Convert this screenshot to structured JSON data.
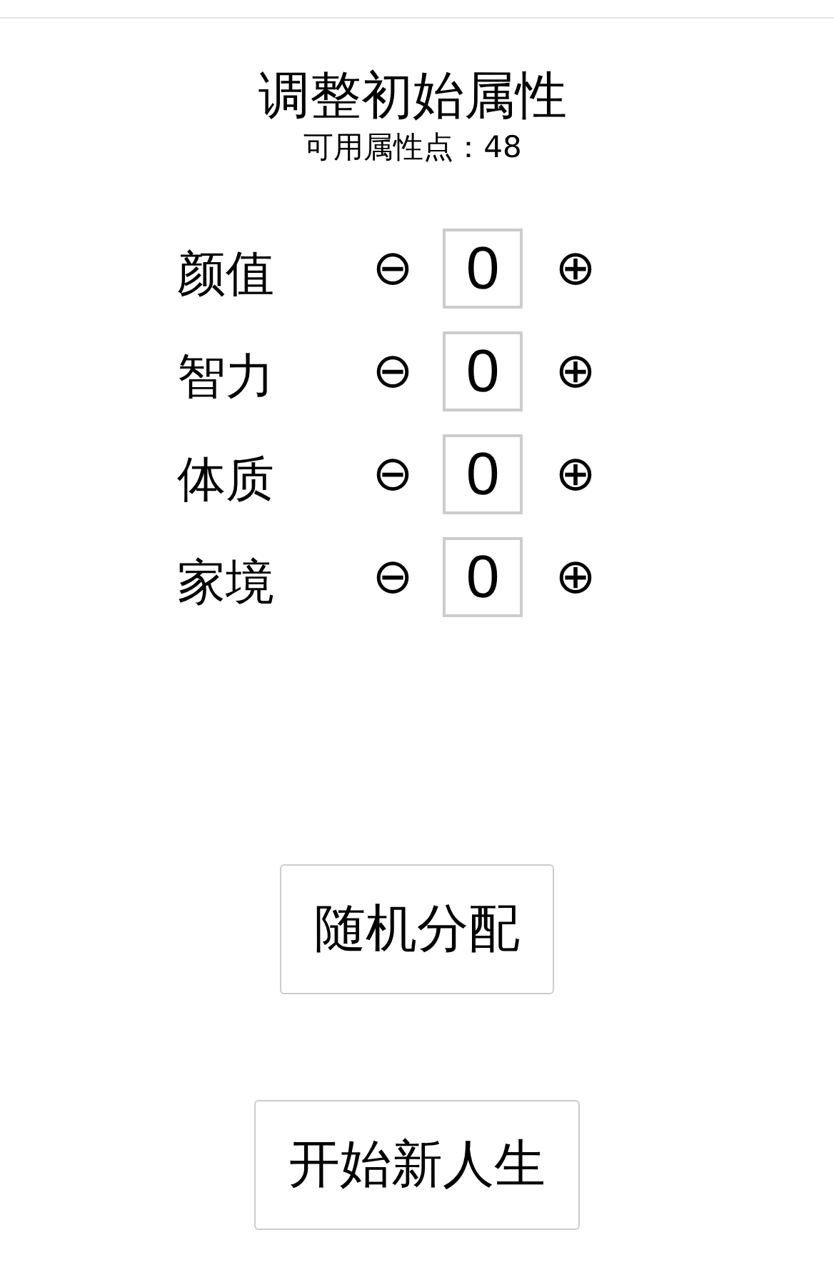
{
  "title": "调整初始属性",
  "available_points": {
    "label": "可用属性点：",
    "value": "48"
  },
  "attributes": [
    {
      "name": "颜值",
      "minus": "⊖",
      "value": "0",
      "plus": "⊕"
    },
    {
      "name": "智力",
      "minus": "⊖",
      "value": "0",
      "plus": "⊕"
    },
    {
      "name": "体质",
      "minus": "⊖",
      "value": "0",
      "plus": "⊕"
    },
    {
      "name": "家境",
      "minus": "⊖",
      "value": "0",
      "plus": "⊕"
    }
  ],
  "buttons": [
    "随机分配",
    "开始新人生"
  ]
}
